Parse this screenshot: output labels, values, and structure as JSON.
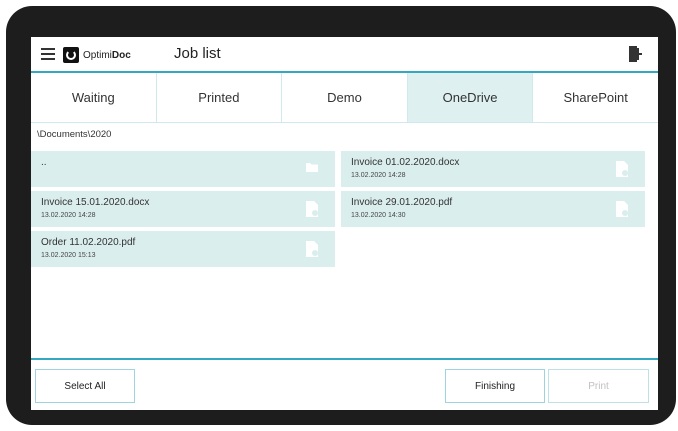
{
  "header": {
    "logo_prefix": "Optimi",
    "logo_suffix": "Doc",
    "title": "Job list",
    "menu_icon": "hamburger-menu-icon",
    "exit_icon": "exit-door-icon"
  },
  "tabs": [
    {
      "label": "Waiting",
      "active": false
    },
    {
      "label": "Printed",
      "active": false
    },
    {
      "label": "Demo",
      "active": false
    },
    {
      "label": "OneDrive",
      "active": true
    },
    {
      "label": "SharePoint",
      "active": false
    }
  ],
  "breadcrumb": "\\Documents\\2020",
  "files": [
    {
      "name": "..",
      "date": "",
      "icon": "folder-icon"
    },
    {
      "name": "Invoice 01.02.2020.docx",
      "date": "13.02.2020 14:28",
      "icon": "document-icon"
    },
    {
      "name": "Invoice 15.01.2020.docx",
      "date": "13.02.2020 14:28",
      "icon": "document-icon"
    },
    {
      "name": "Invoice 29.01.2020.pdf",
      "date": "13.02.2020 14:30",
      "icon": "document-icon"
    },
    {
      "name": "Order 11.02.2020.pdf",
      "date": "13.02.2020 15:13",
      "icon": "document-icon"
    }
  ],
  "footer": {
    "select_all": "Select All",
    "finishing": "Finishing",
    "print": "Print"
  },
  "colors": {
    "accent": "#34a7c1",
    "tile": "#dbeeee",
    "active_tab": "#dff0f1",
    "bezel": "#1d1d1d"
  }
}
